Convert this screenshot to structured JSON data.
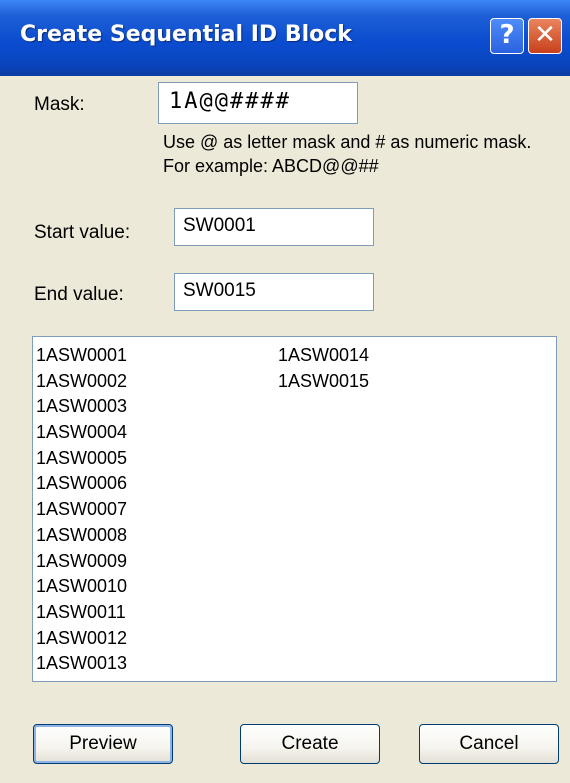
{
  "window": {
    "title": "Create Sequential ID Block",
    "help_glyph": "?",
    "close_glyph": "✕"
  },
  "mask": {
    "label": "Mask:",
    "value": "1A@@####",
    "hint": "Use @ as letter mask and # as numeric mask. For example: ABCD@@##"
  },
  "start": {
    "label": "Start value:",
    "value": "SW0001"
  },
  "end": {
    "label": "End value:",
    "value": "SW0015"
  },
  "preview_list": {
    "column1": [
      "1ASW0001",
      "1ASW0002",
      "1ASW0003",
      "1ASW0004",
      "1ASW0005",
      "1ASW0006",
      "1ASW0007",
      "1ASW0008",
      "1ASW0009",
      "1ASW0010",
      "1ASW0011",
      "1ASW0012",
      "1ASW0013"
    ],
    "column2": [
      "1ASW0014",
      "1ASW0015"
    ]
  },
  "buttons": {
    "preview": "Preview",
    "create": "Create",
    "cancel": "Cancel"
  }
}
